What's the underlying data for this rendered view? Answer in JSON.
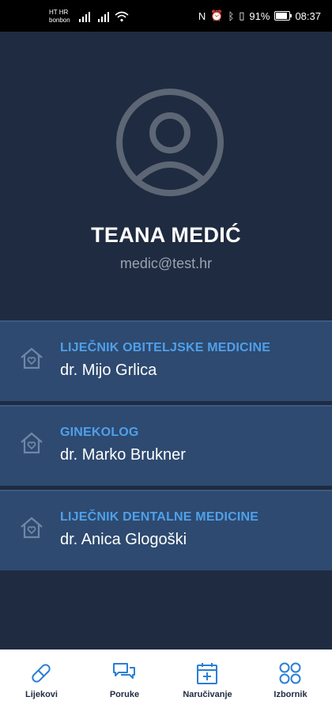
{
  "status_bar": {
    "carrier_line1": "HT HR",
    "carrier_line2": "bonbon",
    "battery": "91%",
    "time": "08:37",
    "icons": [
      "nfc-icon",
      "alarm-icon",
      "bluetooth-icon",
      "vibrate-icon",
      "battery-icon"
    ]
  },
  "profile": {
    "name": "TEANA MEDIĆ",
    "email": "medic@test.hr",
    "avatar_icon": "user-circle-icon"
  },
  "doctors": [
    {
      "role": "LIJEČNIK OBITELJSKE MEDICINE",
      "name": "dr. Mijo Grlica",
      "icon": "home-icon"
    },
    {
      "role": "GINEKOLOG",
      "name": "dr. Marko Brukner",
      "icon": "home-icon"
    },
    {
      "role": "LIJEČNIK DENTALNE MEDICINE",
      "name": "dr. Anica Glogoški",
      "icon": "home-icon"
    }
  ],
  "bottom_nav": [
    {
      "label": "Lijekovi",
      "icon": "pill-icon"
    },
    {
      "label": "Poruke",
      "icon": "chat-icon"
    },
    {
      "label": "Naručivanje",
      "icon": "calendar-icon"
    },
    {
      "label": "Izbornik",
      "icon": "menu-grid-icon"
    }
  ],
  "colors": {
    "background": "#1f2b40",
    "card": "#2e4a70",
    "accent": "#4fa0ea",
    "nav_icon": "#2a7fd4"
  }
}
